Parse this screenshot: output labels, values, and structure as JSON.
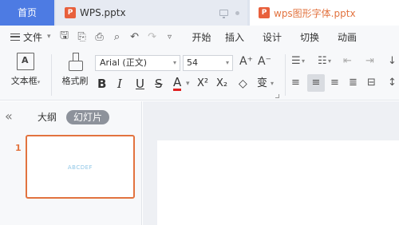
{
  "tabs": {
    "home": "首页",
    "doc1": {
      "badge": "P",
      "name": "WPS.pptx"
    },
    "doc2": {
      "badge": "P",
      "name": "wps图形字体.pptx"
    }
  },
  "menu": {
    "file": "文件",
    "items": [
      "开始",
      "插入",
      "设计",
      "切换",
      "动画"
    ]
  },
  "ribbon": {
    "textbox_label": "文本框",
    "format_painter_label": "格式刷",
    "font_name": "Arial (正文)",
    "font_size": "54",
    "grow": "A⁺",
    "shrink": "A⁻",
    "bold": "B",
    "italic": "I",
    "underline": "U",
    "strike": "S",
    "color": "A",
    "superscript": "X²",
    "subscript": "X₂",
    "eraser": "◇",
    "phonetic": "变"
  },
  "panel": {
    "outline_tab": "大纲",
    "slides_tab": "幻灯片",
    "slide_number": "1",
    "thumb_text": "ABCDEF"
  },
  "colors": {
    "accent": "#e2733f",
    "home_tab": "#4d7be3"
  }
}
